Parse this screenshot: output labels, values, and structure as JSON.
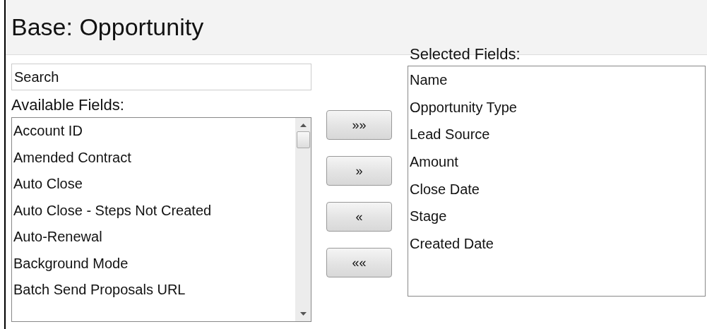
{
  "header": {
    "title": "Base: Opportunity"
  },
  "search": {
    "placeholder": "Search"
  },
  "available": {
    "label": "Available Fields:",
    "items": [
      "Account ID",
      "Amended Contract",
      "Auto Close",
      "Auto Close - Steps Not Created",
      "Auto-Renewal",
      "Background Mode",
      "Batch Send Proposals URL"
    ]
  },
  "buttons": [
    "»»",
    "»",
    "«",
    "««"
  ],
  "selected": {
    "label": "Selected Fields:",
    "items": [
      "Name",
      "Opportunity Type",
      "Lead Source",
      "Amount",
      "Close Date",
      "Stage",
      "Created Date"
    ]
  }
}
